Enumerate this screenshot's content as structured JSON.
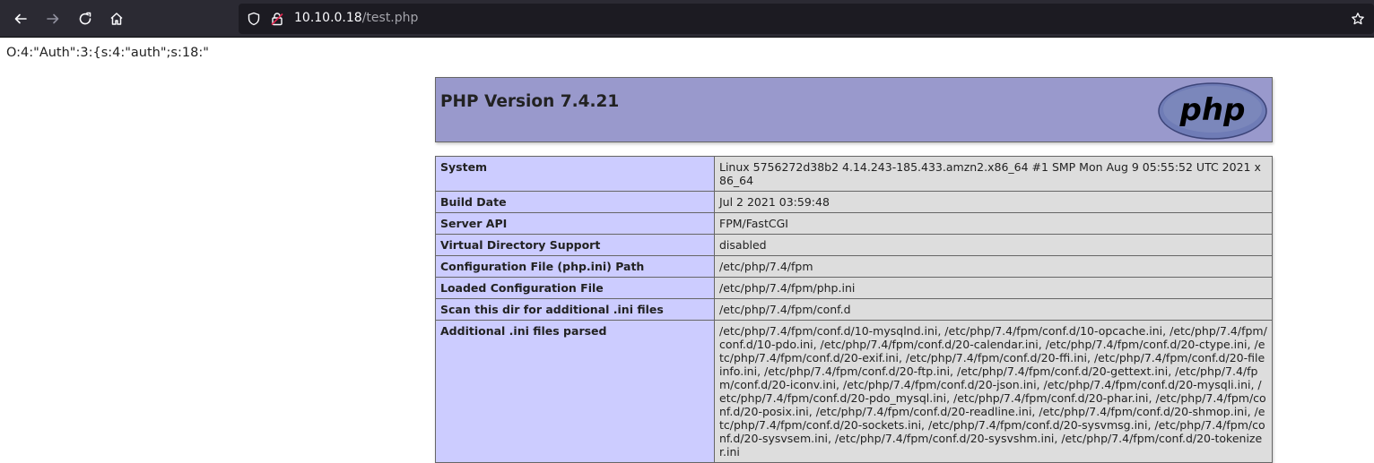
{
  "browser": {
    "url_host": "10.10.0.18",
    "url_path": "/test.php"
  },
  "page": {
    "serialized_text": "O:4:\"Auth\":3:{s:4:\"auth\";s:18:\"",
    "php_version_title": "PHP Version 7.4.21",
    "logo_text": "php"
  },
  "info_rows": [
    {
      "key": "System",
      "value": "Linux 5756272d38b2 4.14.243-185.433.amzn2.x86_64 #1 SMP Mon Aug 9 05:55:52 UTC 2021 x86_64"
    },
    {
      "key": "Build Date",
      "value": "Jul 2 2021 03:59:48"
    },
    {
      "key": "Server API",
      "value": "FPM/FastCGI"
    },
    {
      "key": "Virtual Directory Support",
      "value": "disabled"
    },
    {
      "key": "Configuration File (php.ini) Path",
      "value": "/etc/php/7.4/fpm"
    },
    {
      "key": "Loaded Configuration File",
      "value": "/etc/php/7.4/fpm/php.ini"
    },
    {
      "key": "Scan this dir for additional .ini files",
      "value": "/etc/php/7.4/fpm/conf.d"
    },
    {
      "key": "Additional .ini files parsed",
      "value": "/etc/php/7.4/fpm/conf.d/10-mysqlnd.ini, /etc/php/7.4/fpm/conf.d/10-opcache.ini, /etc/php/7.4/fpm/conf.d/10-pdo.ini, /etc/php/7.4/fpm/conf.d/20-calendar.ini, /etc/php/7.4/fpm/conf.d/20-ctype.ini, /etc/php/7.4/fpm/conf.d/20-exif.ini, /etc/php/7.4/fpm/conf.d/20-ffi.ini, /etc/php/7.4/fpm/conf.d/20-fileinfo.ini, /etc/php/7.4/fpm/conf.d/20-ftp.ini, /etc/php/7.4/fpm/conf.d/20-gettext.ini, /etc/php/7.4/fpm/conf.d/20-iconv.ini, /etc/php/7.4/fpm/conf.d/20-json.ini, /etc/php/7.4/fpm/conf.d/20-mysqli.ini, /etc/php/7.4/fpm/conf.d/20-pdo_mysql.ini, /etc/php/7.4/fpm/conf.d/20-phar.ini, /etc/php/7.4/fpm/conf.d/20-posix.ini, /etc/php/7.4/fpm/conf.d/20-readline.ini, /etc/php/7.4/fpm/conf.d/20-shmop.ini, /etc/php/7.4/fpm/conf.d/20-sockets.ini, /etc/php/7.4/fpm/conf.d/20-sysvmsg.ini, /etc/php/7.4/fpm/conf.d/20-sysvsem.ini, /etc/php/7.4/fpm/conf.d/20-sysvshm.ini, /etc/php/7.4/fpm/conf.d/20-tokenizer.ini"
    }
  ],
  "colors": {
    "toolbar_bg": "#2b2a33",
    "urlbar_bg": "#1c1b22",
    "header_bg": "#9999cc",
    "key_cell_bg": "#ccccff",
    "value_cell_bg": "#dddddd"
  },
  "icons": [
    "back-arrow-icon",
    "forward-arrow-icon",
    "reload-icon",
    "home-icon",
    "shield-icon",
    "lock-icon",
    "star-icon"
  ]
}
